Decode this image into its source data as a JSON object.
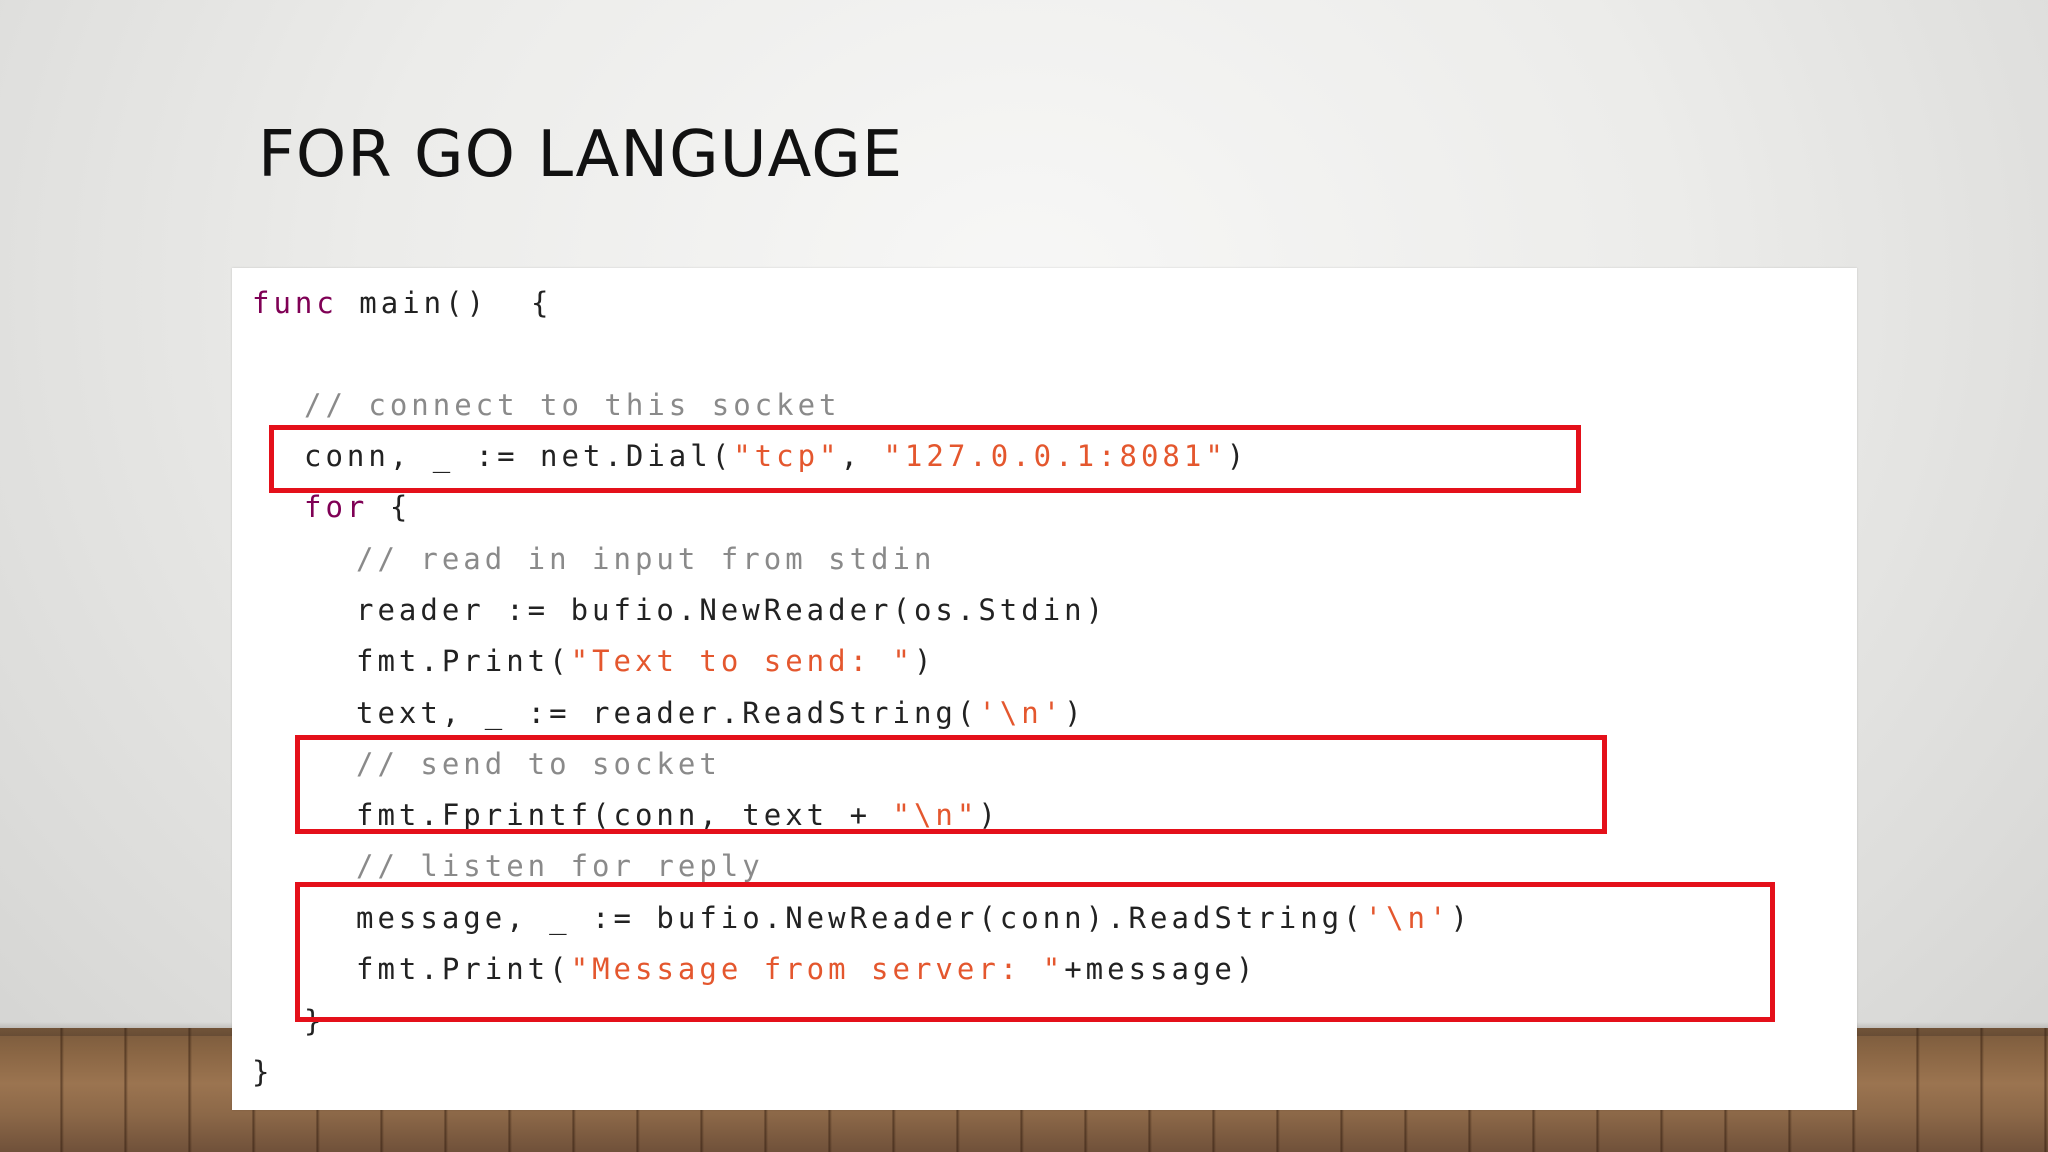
{
  "slide": {
    "title": "FOR GO LANGUAGE"
  },
  "code": {
    "l1_func": "func",
    "l1_rest": " main()  {",
    "l3_comment": "// connect to this socket",
    "l4_a": "conn, _ := net.Dial(",
    "l4_s1": "\"tcp\"",
    "l4_b": ", ",
    "l4_s2": "\"127.0.0.1:8081\"",
    "l4_c": ")",
    "l5_for": "for",
    "l5_rest": " {",
    "l6_comment": "// read in input from stdin",
    "l7": "reader := bufio.NewReader(os.Stdin)",
    "l8_a": "fmt.Print(",
    "l8_s": "\"Text to send: \"",
    "l8_c": ")",
    "l9_a": "text, _ := reader.ReadString(",
    "l9_s": "'\\n'",
    "l9_c": ")",
    "l10_comment": "// send to socket",
    "l11_a": "fmt.Fprintf(conn, text + ",
    "l11_s": "\"\\n\"",
    "l11_c": ")",
    "l12_comment": "// listen for reply",
    "l13_a": "message, _ := bufio.NewReader(conn).ReadString(",
    "l13_s": "'\\n'",
    "l13_c": ")",
    "l14_a": "fmt.Print(",
    "l14_s": "\"Message from server: \"",
    "l14_c": "+message)",
    "l15": "}",
    "l16": "}"
  },
  "colors": {
    "keyword": "#7f0055",
    "string": "#e4572e",
    "comment": "#8a8a8a",
    "highlight_box": "#e4101a"
  }
}
